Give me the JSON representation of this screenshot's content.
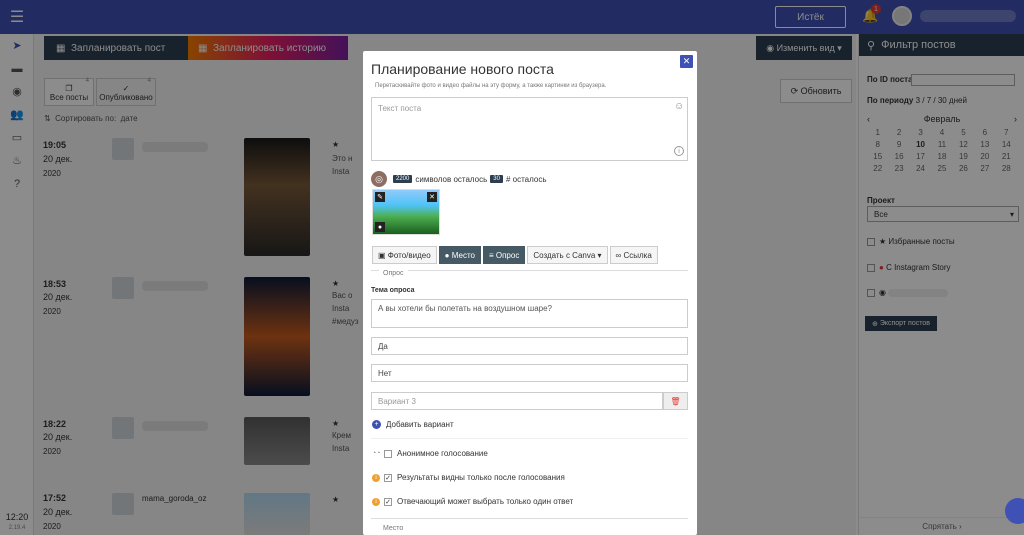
{
  "topbar": {
    "menu_icon": "hamburger-icon",
    "expired_label": "Истёк",
    "bell_count": "1",
    "accent_color": "#3f51b5"
  },
  "leftnav": {
    "items": [
      "send-icon",
      "folder-icon",
      "palette-icon",
      "users-icon",
      "card-icon",
      "fire-icon",
      "help-icon"
    ],
    "time": "12:20",
    "version": "2.19.4"
  },
  "toolbar": {
    "plan_post_label": "Запланировать пост",
    "plan_story_label": "Запланировать историю",
    "change_view_label": "Изменить вид",
    "refresh_label": "Обновить"
  },
  "tabs": [
    {
      "label": "Все посты",
      "count": "4"
    },
    {
      "label": "Опубликовано",
      "count": "4"
    }
  ],
  "sort": {
    "label": "Сортировать по:",
    "value": "дате"
  },
  "posts": [
    {
      "time": "19:05",
      "date": "20 дек.",
      "year": "2020",
      "text": "Это н",
      "source": "Insta"
    },
    {
      "time": "18:53",
      "date": "20 дек.",
      "year": "2020",
      "text": "Вас о",
      "source": "Insta",
      "tag": "#медуз"
    },
    {
      "time": "18:22",
      "date": "20 дек.",
      "year": "2020",
      "text": "Крем",
      "source": "Insta"
    },
    {
      "time": "17:52",
      "date": "20 дек.",
      "year": "2020",
      "account": "mama_goroda_oz"
    }
  ],
  "filter": {
    "title": "Фильтр постов",
    "by_id_label": "По ID поста",
    "by_period_label": "По периоду",
    "period_options": "3 / 7 / 30 дней",
    "month": "Февраль",
    "calendar": [
      "1",
      "2",
      "3",
      "4",
      "5",
      "6",
      "7",
      "8",
      "9",
      "10",
      "11",
      "12",
      "13",
      "14",
      "15",
      "16",
      "17",
      "18",
      "19",
      "20",
      "21",
      "22",
      "23",
      "24",
      "25",
      "26",
      "27",
      "28"
    ],
    "today": "10",
    "project_label": "Проект",
    "project_value": "Все",
    "favorites_label": "Избранные посты",
    "story_label": "С Instagram Story",
    "export_label": "Экспорт постов",
    "collapse_label": "Спрятать"
  },
  "modal": {
    "title": "Планирование нового поста",
    "hint": "Перетаскивайте фото и видео файлы на эту форму, а также картинки из браузера.",
    "text_placeholder": "Текст поста",
    "chars_left_count": "2200",
    "chars_left_label": "символов осталось",
    "hashtags_count": "30",
    "hashtags_label": "# осталось",
    "buttons": {
      "photo_video": "Фото/видео",
      "place": "Место",
      "poll": "Опрос",
      "canva": "Создать с Canva",
      "link": "Ссылка"
    },
    "poll_section_label": "Опрос",
    "poll_topic_label": "Тема опроса",
    "poll_topic_value": "А вы хотели бы полетать на воздушном шаре?",
    "option1": "Да",
    "option2": "Нет",
    "option3_placeholder": "Вариант 3",
    "add_option_label": "Добавить вариант",
    "anonymous_label": "Анонимное голосование",
    "results_after_label": "Результаты видны только после голосования",
    "single_answer_label": "Отвечающий может выбрать только один ответ",
    "place_section_label": "Место"
  }
}
